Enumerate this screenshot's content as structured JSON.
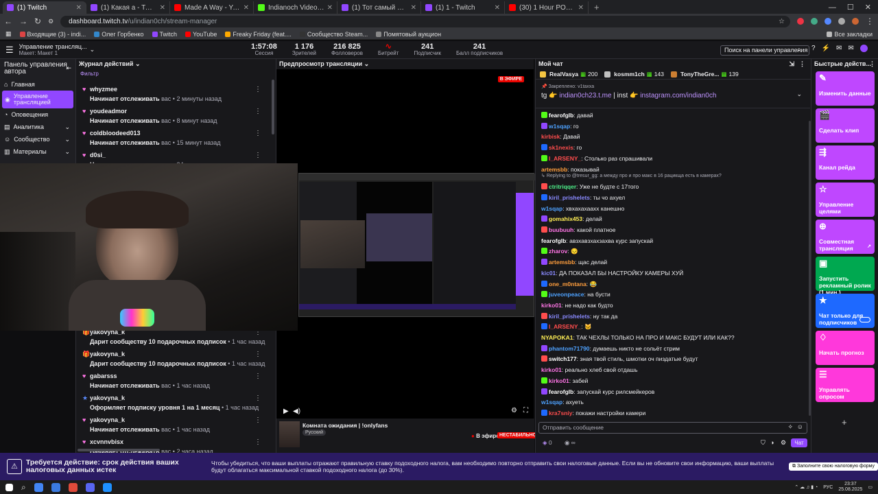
{
  "browser": {
    "tabs": [
      {
        "title": "(1) Twitch",
        "color": "#9147ff",
        "active": true
      },
      {
        "title": "(1) Какая а - Twitch",
        "color": "#9147ff"
      },
      {
        "title": "Made A Way - YouTube M",
        "color": "#ff0000"
      },
      {
        "title": "Indianoch Videos - Watch On",
        "color": "#53fc18"
      },
      {
        "title": "(1) Тот самый боец - Twitch",
        "color": "#9147ff"
      },
      {
        "title": "(1) 1 - Twitch",
        "color": "#9147ff"
      },
      {
        "title": "(30) 1 Hour POV | Porsche 992",
        "color": "#ff0000"
      }
    ],
    "url_host": "dashboard.twitch.tv",
    "url_path": "/u/indian0ch/stream-manager",
    "bookmarks": [
      "Входящие (3) - indi...",
      "Олег Горбенко",
      "Twitch",
      "YouTube",
      "Freaky Friday (feat....",
      "Сообщество Steam...",
      "Помятовый аукцион"
    ],
    "all_bookmarks": "Все закладки"
  },
  "topbar": {
    "title": "Управление трансляц...",
    "subtitle": "Макет: Макет 1",
    "stats": [
      {
        "value": "1:57:08",
        "label": "Сессия"
      },
      {
        "value": "1 176",
        "label": "Зрителей"
      },
      {
        "value": "216 825",
        "label": "Фолловеров"
      },
      {
        "value": "",
        "label": "Битрейт"
      },
      {
        "value": "241",
        "label": "Подписчик"
      },
      {
        "value": "241",
        "label": "Балл подписчиков"
      }
    ],
    "search_placeholder": "Поиск на панели управления"
  },
  "leftnav": {
    "header": "Панель управления автора",
    "items": [
      "Главная",
      "Управление трансляцией",
      "Оповещения",
      "Аналитика",
      "Сообщество",
      "Материалы"
    ]
  },
  "feed": {
    "header": "Журнал действий",
    "filter": "Фильтр",
    "items": [
      {
        "name": "whyzmee",
        "action": "Начинает отслеживать",
        "tail": " вас • 2 минуты назад",
        "icon": "♥",
        "color": "#ff75e6"
      },
      {
        "name": "youdeadmor",
        "action": "Начинает отслеживать",
        "tail": " вас • 8 минут назад",
        "icon": "♥",
        "color": "#ff75e6"
      },
      {
        "name": "coldbloodeed013",
        "action": "Начинает отслеживать",
        "tail": " вас • 15 минут назад",
        "icon": "♥",
        "color": "#ff75e6"
      },
      {
        "name": "d0si_",
        "action": "Начинает отслеживать",
        "tail": " вас • 24 минуты назад",
        "icon": "♥",
        "color": "#ff75e6"
      },
      {
        "name": "yakovyna_k",
        "action": "Дарит сообществу 10 подарочных подписок",
        "tail": " • 1 час назад",
        "icon": "🎁",
        "color": "#ff75e6"
      },
      {
        "name": "yakovyna_k",
        "action": "Дарит сообществу 10 подарочных подписок",
        "tail": " • 1 час назад",
        "icon": "🎁",
        "color": "#5c8cff"
      },
      {
        "name": "gabarsss",
        "action": "Начинает отслеживать",
        "tail": " вас • 1 час назад",
        "icon": "♥",
        "color": "#ff75e6"
      },
      {
        "name": "yakovyna_k",
        "action": "Оформляет подписку уровня 1 на 1 месяц",
        "tail": " • 1 час назад",
        "icon": "★",
        "color": "#5c8cff"
      },
      {
        "name": "yakovyna_k",
        "action": "Начинает отслеживать",
        "tail": " вас • 1 час назад",
        "icon": "♥",
        "color": "#ff75e6"
      },
      {
        "name": "xcvnnvbisx",
        "action": "Начинает отслеживать",
        "tail": " вас • 2 часа назад",
        "icon": "♥",
        "color": "#ff75e6"
      }
    ]
  },
  "preview": {
    "header": "Предпросмотр трансляции",
    "live_badge": "В ЭФИРЕ",
    "stream_title": "Комната ожидания | !onlyfans",
    "language": "Русский",
    "status": "В эфире",
    "stability": "НЕСТАБИЛЬНО"
  },
  "chat": {
    "header": "Мой чат",
    "top_users": [
      {
        "name": "RealVasya",
        "count": "200"
      },
      {
        "name": "kosmm1ch",
        "count": "143"
      },
      {
        "name": "TonyTheGre...",
        "count": "139"
      }
    ],
    "pinned_label": "Закреплено:",
    "pinned_by": "v1taxxa",
    "pinned_text_tg": "tg 👉 ",
    "pinned_link1": "indian0ch23.t.me",
    "pinned_mid": " | inst 👉 ",
    "pinned_link2": "instagram.com/indian0ch",
    "messages": [
      {
        "user": "fearofglb",
        "color": "#ffffff",
        "text": ": давай"
      },
      {
        "user": "w1sqap",
        "color": "#4ea2ff",
        "text": ": го"
      },
      {
        "user": "kirbisk",
        "color": "#ff4d4d",
        "text": ": Давай"
      },
      {
        "user": "sk1nexis",
        "color": "#ff4d4d",
        "text": ": го"
      },
      {
        "user": "I_ARSENY_",
        "color": "#ff4d4d",
        "text": ": Столько раз спрашивали"
      },
      {
        "user": "artemsbb",
        "color": "#ff9e3d",
        "text": ": показывай"
      },
      {
        "user": "ctritriqqer",
        "color": "#4ef08a",
        "text": ": Уже не будте с 17того",
        "reply": "Replying to @tresur_gg: а между про и про макс в 16 рацикща есть в камерах?"
      },
      {
        "user": "kiril_prishelets",
        "color": "#8a8aff",
        "text": ": ты чо ахуел"
      },
      {
        "user": "w1sqap",
        "color": "#4ea2ff",
        "text": ": хвхахахаахх канешно"
      },
      {
        "user": "gomahix453",
        "color": "#ffee55",
        "text": ": делай"
      },
      {
        "user": "buubuuh",
        "color": "#ff75e6",
        "text": ": какой платное"
      },
      {
        "user": "fearofglb",
        "color": "#ffffff",
        "text": ": авзхавзхахзахва курс запускай"
      },
      {
        "user": "zharov",
        "color": "#ff75e6",
        "text": ": 😔"
      },
      {
        "user": "artemsbb",
        "color": "#ff9e3d",
        "text": ": щас делай"
      },
      {
        "user": "kic01",
        "color": "#8a8aff",
        "text": ": ДА ПОКАЗАЛ БЫ НАСТРОЙКУ КАМЕРЫ ХУЙ"
      },
      {
        "user": "one_m0ntana",
        "color": "#ff9e3d",
        "text": ": 😂"
      },
      {
        "user": "juveonpeace",
        "color": "#4ea2ff",
        "text": ": на бусти"
      },
      {
        "user": "kirko01",
        "color": "#ff75e6",
        "text": ": не надо как будто"
      },
      {
        "user": "kiril_prishelets",
        "color": "#8a8aff",
        "text": ": ну так да"
      },
      {
        "user": "I_ARSENY_",
        "color": "#ff4d4d",
        "text": ": 🐱"
      },
      {
        "user": "NYAPOKA1",
        "color": "#ffee55",
        "text": ": ТАК ЧЕХЛЫ ТОЛЬКО НА ПРО И МАКС БУДУТ ИЛИ КАК??"
      },
      {
        "user": "phantom71790",
        "color": "#4ea2ff",
        "text": ": думаешь никто не сольёт стрим"
      },
      {
        "user": "switch177",
        "color": "#ffffff",
        "text": ": зная твой стиль, шмотки оч пиздатые будут"
      },
      {
        "user": "kirko01",
        "color": "#ff75e6",
        "text": ": реально хлеб свой отдашь"
      },
      {
        "user": "kirko01",
        "color": "#ff75e6",
        "text": ": забей"
      },
      {
        "user": "fearofglb",
        "color": "#ffffff",
        "text": ": запускай курс рилсмейкеров"
      },
      {
        "user": "w1sqap",
        "color": "#4ea2ff",
        "text": ": ахуеть"
      },
      {
        "user": "kra7sniy",
        "color": "#ff4d4d",
        "text": ": покажи настройки камери"
      }
    ],
    "input_placeholder": "Отправить сообщение",
    "points": "0",
    "send_label": "Чат"
  },
  "quick": {
    "header": "Быстрые действ...",
    "items": [
      {
        "label": "Изменить данные",
        "icon": "✎",
        "color": "#bf47ff"
      },
      {
        "label": "Сделать клип",
        "icon": "🎬",
        "color": "#bf47ff"
      },
      {
        "label": "Канал рейда",
        "icon": "⇶",
        "color": "#bf47ff"
      },
      {
        "label": "Управление целями",
        "icon": "☆",
        "color": "#bf47ff"
      },
      {
        "label": "Совместная трансляция",
        "icon": "⊕",
        "color": "#bf47ff"
      },
      {
        "label": "Запустить рекламный ролик (1 мин.)",
        "icon": "▣",
        "color": "#00a850"
      },
      {
        "label": "Чат только для подписчиков",
        "icon": "★",
        "color": "#1e69ff"
      },
      {
        "label": "Начать прогноз",
        "icon": "♢",
        "color": "#ff38db"
      },
      {
        "label": "Управлять опросом",
        "icon": "☰",
        "color": "#ff38db"
      }
    ]
  },
  "banner": {
    "title": "Требуется действие: срок действия ваших налоговых данных истек",
    "text": "Чтобы убедиться, что ваши выплаты отражают правильную ставку подоходного налога, вам необходимо повторно отправить свои налоговые данные. Если вы не обновите свои информацию, ваши выплаты будут облагаться максимальной ставкой подоходного налога (до 30%).",
    "button": "Заполните свою налоговую форму"
  },
  "taskbar": {
    "lang": "РУС",
    "time": "23:37",
    "date": "25.08.2025"
  }
}
